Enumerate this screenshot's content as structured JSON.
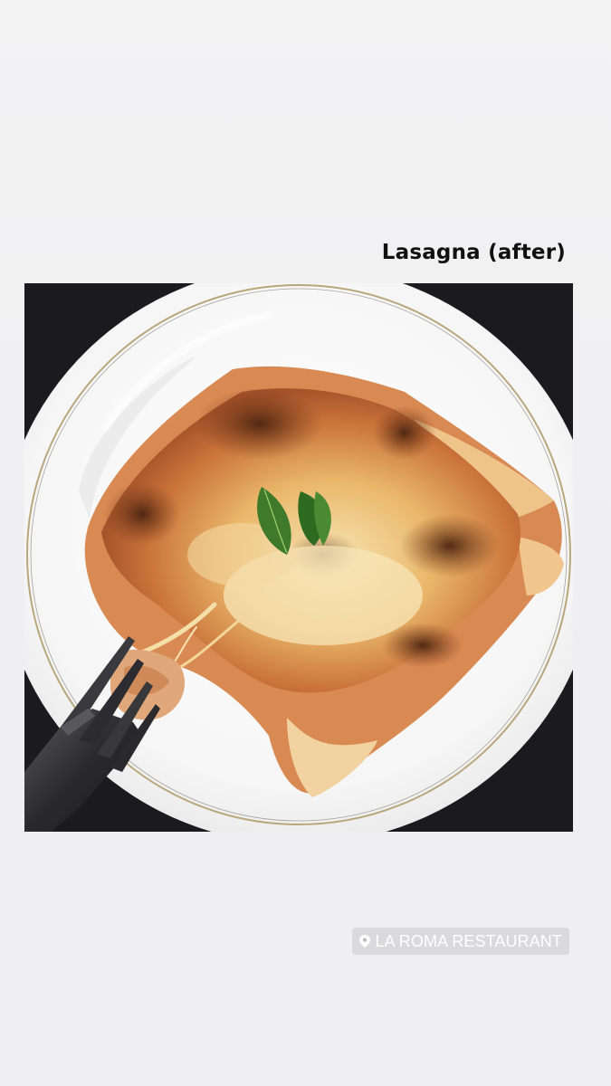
{
  "story": {
    "caption": "Lasagna (after)",
    "location_sticker": {
      "icon": "location-pin-icon",
      "label": "LA ROMA RESTAURANT"
    }
  },
  "colors": {
    "background": "#efeff1",
    "caption_text": "#111111",
    "sticker_bg": "#c8c8cc",
    "sticker_text": "#ffffff"
  }
}
